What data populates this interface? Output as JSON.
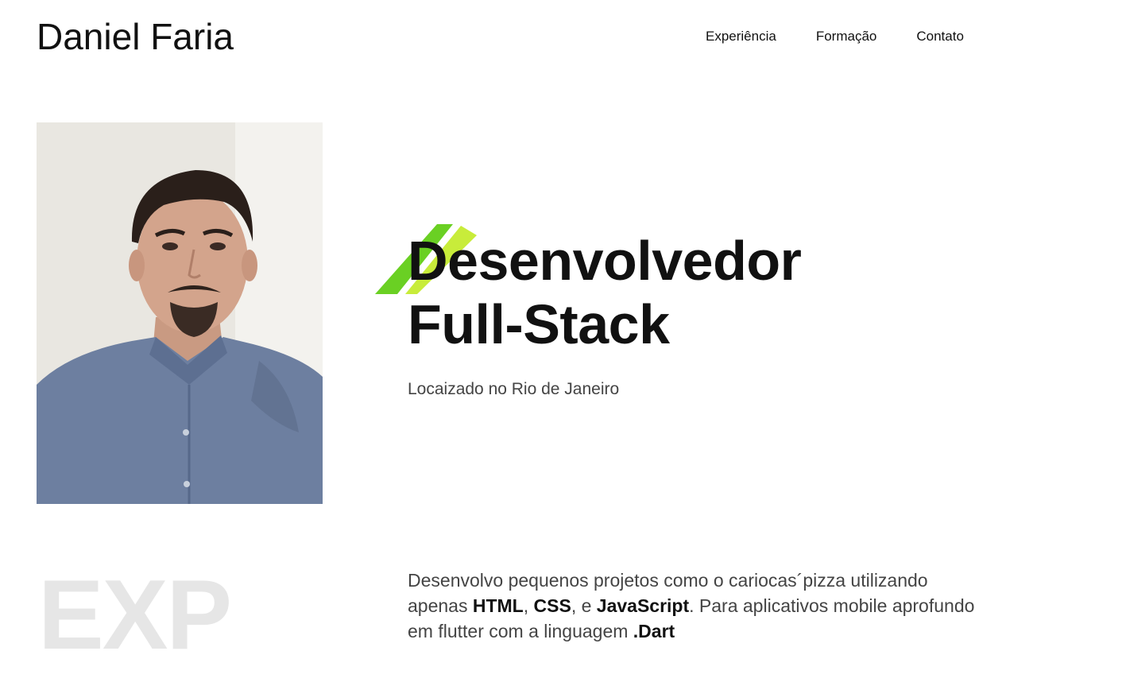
{
  "header": {
    "brand": "Daniel Faria",
    "nav": [
      {
        "label": "Experiência"
      },
      {
        "label": "Formação"
      },
      {
        "label": "Contato"
      }
    ]
  },
  "hero": {
    "headline_line1": "Desenvolvedor",
    "headline_line2": "Full-Stack",
    "location": "Locaizado no Rio de Janeiro",
    "accent_colors": [
      "#6ad023",
      "#c8ec3a"
    ],
    "photo_icon": "profile-photo"
  },
  "experience": {
    "watermark": "EXP",
    "description": {
      "part1": "Desenvolvo pequenos projetos como o cariocas´pizza utilizando apenas ",
      "html": "HTML",
      "sep1": ", ",
      "css": "CSS",
      "sep2": ", e ",
      "js": "JavaScript",
      "part2": ". Para aplicativos mobile aprofundo em flutter com a linguagem ",
      "dart": ".Dart"
    }
  }
}
